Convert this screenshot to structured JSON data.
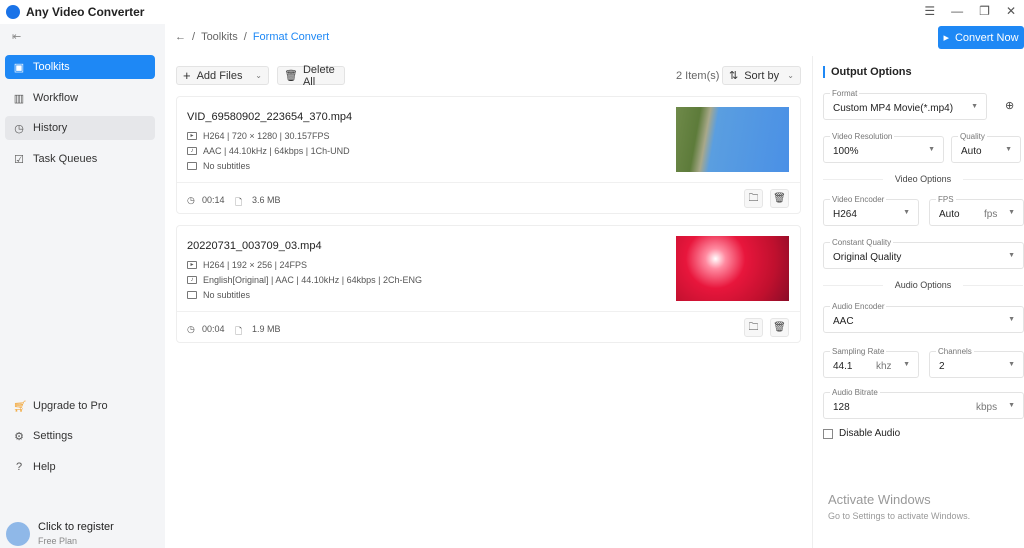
{
  "app": {
    "title": "Any Video Converter"
  },
  "sidebar": {
    "items": [
      {
        "label": "Toolkits"
      },
      {
        "label": "Workflow"
      },
      {
        "label": "History"
      },
      {
        "label": "Task Queues"
      }
    ],
    "bottom": [
      {
        "label": "Upgrade to Pro"
      },
      {
        "label": "Settings"
      },
      {
        "label": "Help"
      }
    ],
    "user": {
      "name": "Click to register",
      "plan": "Free Plan"
    }
  },
  "breadcrumb": {
    "sep": "/",
    "items": [
      "Toolkits",
      "Format Convert"
    ]
  },
  "convert_label": "Convert Now",
  "toolbar": {
    "add": "Add Files",
    "delete": "Delete All",
    "count": "2 Item(s)",
    "sort": "Sort by"
  },
  "files": [
    {
      "name": "VID_69580902_223654_370.mp4",
      "video": "H264 | 720 × 1280 | 30.157FPS",
      "audio": "AAC | 44.10kHz | 64kbps | 1Ch-UND",
      "subs": "No subtitles",
      "duration": "00:14",
      "size": "3.6 MB"
    },
    {
      "name": "20220731_003709_03.mp4",
      "video": "H264 | 192 × 256 | 24FPS",
      "audio": "English[Original] | AAC | 44.10kHz | 64kbps | 2Ch-ENG",
      "subs": "No subtitles",
      "duration": "00:04",
      "size": "1.9 MB"
    }
  ],
  "options": {
    "title": "Output Options",
    "format": {
      "label": "Format",
      "value": "Custom MP4 Movie(*.mp4)"
    },
    "resolution": {
      "label": "Video Resolution",
      "value": "100%"
    },
    "quality": {
      "label": "Quality",
      "value": "Auto"
    },
    "video_section": "Video Options",
    "encoder": {
      "label": "Video Encoder",
      "value": "H264"
    },
    "fps": {
      "label": "FPS",
      "value": "Auto",
      "unit": "fps"
    },
    "cq": {
      "label": "Constant Quality",
      "value": "Original Quality"
    },
    "audio_section": "Audio Options",
    "aencoder": {
      "label": "Audio Encoder",
      "value": "AAC"
    },
    "sr": {
      "label": "Sampling Rate",
      "value": "44.1",
      "unit": "khz"
    },
    "channels": {
      "label": "Channels",
      "value": "2"
    },
    "abitrate": {
      "label": "Audio Bitrate",
      "value": "128",
      "unit": "kbps"
    },
    "disable_audio": "Disable Audio"
  },
  "watermark": {
    "line1": "Activate Windows",
    "line2": "Go to Settings to activate Windows."
  }
}
